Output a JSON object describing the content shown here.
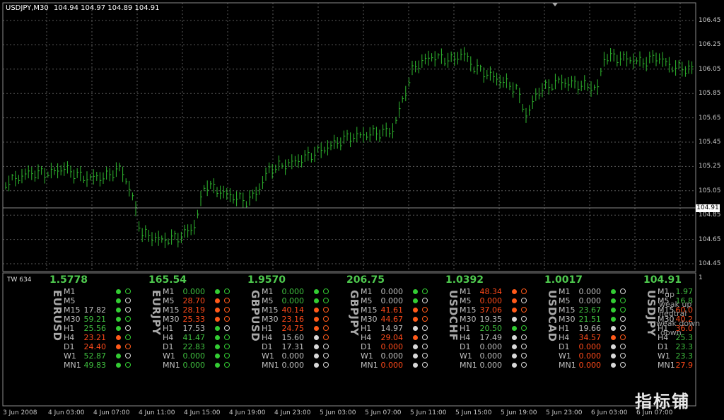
{
  "window": {
    "title": "USDJPY,M30",
    "ohlc": "104.94 104.97 104.89 104.91",
    "current_price": "104.91"
  },
  "indicator_window": {
    "title": "TW 634",
    "scale_max": "1"
  },
  "price_axis": {
    "ticks": [
      "106.45",
      "106.25",
      "106.05",
      "105.85",
      "105.65",
      "105.45",
      "105.25",
      "105.05",
      "104.85",
      "104.65",
      "104.45"
    ]
  },
  "time_axis": {
    "ticks": [
      "3 Jun 2008",
      "4 Jun 03:00",
      "4 Jun 07:00",
      "4 Jun 11:00",
      "4 Jun 15:00",
      "4 Jun 19:00",
      "4 Jun 23:00",
      "5 Jun 03:00",
      "5 Jun 07:00",
      "5 Jun 11:00",
      "5 Jun 15:00",
      "5 Jun 19:00",
      "5 Jun 23:00",
      "6 Jun 03:00",
      "6 Jun 07:00"
    ]
  },
  "colors": {
    "background": "#000000",
    "grid": "#5a5a5a",
    "bars": "#2fb82f",
    "bullish": "#33cc33",
    "bearish": "#ff5a1a",
    "neutral": "#d8d8d8"
  },
  "timeframes": [
    "M1",
    "M5",
    "M15",
    "M30",
    "H1",
    "H4",
    "D1",
    "W1",
    "MN1"
  ],
  "panels": [
    {
      "symbol": "EURUSD",
      "price": "1.5778",
      "rows": [
        {
          "value": "",
          "vc": "w",
          "dot": "g",
          "ring": "g"
        },
        {
          "value": "",
          "vc": "w",
          "dot": "g",
          "ring": "w"
        },
        {
          "value": "17.82",
          "vc": "w",
          "dot": "g",
          "ring": "w"
        },
        {
          "value": "59.21",
          "vc": "g",
          "dot": "g",
          "ring": "g"
        },
        {
          "value": "25.56",
          "vc": "g",
          "dot": "g",
          "ring": "w"
        },
        {
          "value": "23.21",
          "vc": "r",
          "dot": "r",
          "ring": "g"
        },
        {
          "value": "24.40",
          "vc": "r",
          "dot": "r",
          "ring": "r"
        },
        {
          "value": "52.87",
          "vc": "g",
          "dot": "g",
          "ring": "w"
        },
        {
          "value": "49.83",
          "vc": "g",
          "dot": "g",
          "ring": "g"
        }
      ]
    },
    {
      "symbol": "EURJPY",
      "price": "165.54",
      "rows": [
        {
          "value": "0.000",
          "vc": "g",
          "dot": "g",
          "ring": "g"
        },
        {
          "value": "28.70",
          "vc": "r",
          "dot": "r",
          "ring": "r"
        },
        {
          "value": "28.19",
          "vc": "r",
          "dot": "r",
          "ring": "r"
        },
        {
          "value": "25.33",
          "vc": "r",
          "dot": "r",
          "ring": "r"
        },
        {
          "value": "17.53",
          "vc": "w",
          "dot": "g",
          "ring": "w"
        },
        {
          "value": "41.47",
          "vc": "g",
          "dot": "g",
          "ring": "g"
        },
        {
          "value": "22.83",
          "vc": "g",
          "dot": "g",
          "ring": "g"
        },
        {
          "value": "0.000",
          "vc": "g",
          "dot": "g",
          "ring": "g"
        },
        {
          "value": "0.000",
          "vc": "g",
          "dot": "g",
          "ring": "g"
        }
      ]
    },
    {
      "symbol": "GBPUSD",
      "price": "1.9570",
      "rows": [
        {
          "value": "0.000",
          "vc": "g",
          "dot": "g",
          "ring": "g"
        },
        {
          "value": "0.000",
          "vc": "g",
          "dot": "g",
          "ring": "g"
        },
        {
          "value": "40.14",
          "vc": "r",
          "dot": "r",
          "ring": "r"
        },
        {
          "value": "23.16",
          "vc": "r",
          "dot": "r",
          "ring": "r"
        },
        {
          "value": "24.75",
          "vc": "r",
          "dot": "r",
          "ring": "r"
        },
        {
          "value": "15.60",
          "vc": "w",
          "dot": "w",
          "ring": "r"
        },
        {
          "value": "17.31",
          "vc": "w",
          "dot": "w",
          "ring": "w"
        },
        {
          "value": "0.000",
          "vc": "w",
          "dot": "w",
          "ring": "w"
        },
        {
          "value": "0.000",
          "vc": "w",
          "dot": "w",
          "ring": "w"
        }
      ]
    },
    {
      "symbol": "GBPJPY",
      "price": "206.75",
      "rows": [
        {
          "value": "0.000",
          "vc": "w",
          "dot": "g",
          "ring": "g"
        },
        {
          "value": "0.000",
          "vc": "w",
          "dot": "g",
          "ring": "w"
        },
        {
          "value": "41.61",
          "vc": "r",
          "dot": "r",
          "ring": "r"
        },
        {
          "value": "44.67",
          "vc": "r",
          "dot": "r",
          "ring": "r"
        },
        {
          "value": "14.97",
          "vc": "w",
          "dot": "w",
          "ring": "w"
        },
        {
          "value": "29.04",
          "vc": "r",
          "dot": "r",
          "ring": "w"
        },
        {
          "value": "0.000",
          "vc": "r",
          "dot": "w",
          "ring": "w"
        },
        {
          "value": "0.000",
          "vc": "w",
          "dot": "w",
          "ring": "w"
        },
        {
          "value": "0.000",
          "vc": "r",
          "dot": "w",
          "ring": "w"
        }
      ]
    },
    {
      "symbol": "USDCHF",
      "price": "1.0392",
      "rows": [
        {
          "value": "48.34",
          "vc": "r",
          "dot": "r",
          "ring": "r"
        },
        {
          "value": "0.000",
          "vc": "r",
          "dot": "r",
          "ring": "w"
        },
        {
          "value": "37.06",
          "vc": "r",
          "dot": "r",
          "ring": "r"
        },
        {
          "value": "19.35",
          "vc": "w",
          "dot": "w",
          "ring": "w"
        },
        {
          "value": "20.50",
          "vc": "g",
          "dot": "g",
          "ring": "g"
        },
        {
          "value": "17.49",
          "vc": "w",
          "dot": "w",
          "ring": "w"
        },
        {
          "value": "0.000",
          "vc": "w",
          "dot": "w",
          "ring": "w"
        },
        {
          "value": "0.000",
          "vc": "w",
          "dot": "w",
          "ring": "w"
        },
        {
          "value": "0.000",
          "vc": "w",
          "dot": "w",
          "ring": "w"
        }
      ]
    },
    {
      "symbol": "USDCAD",
      "price": "1.0017",
      "rows": [
        {
          "value": "0.000",
          "vc": "w",
          "dot": "g",
          "ring": "w"
        },
        {
          "value": "0.000",
          "vc": "w",
          "dot": "g",
          "ring": "g"
        },
        {
          "value": "23.67",
          "vc": "g",
          "dot": "g",
          "ring": "g"
        },
        {
          "value": "21.51",
          "vc": "g",
          "dot": "g",
          "ring": "w"
        },
        {
          "value": "19.66",
          "vc": "w",
          "dot": "w",
          "ring": "w"
        },
        {
          "value": "34.57",
          "vc": "r",
          "dot": "r",
          "ring": "r"
        },
        {
          "value": "0.000",
          "vc": "r",
          "dot": "w",
          "ring": "w"
        },
        {
          "value": "0.000",
          "vc": "r",
          "dot": "w",
          "ring": "w"
        },
        {
          "value": "0.000",
          "vc": "r",
          "dot": "w",
          "ring": "w"
        }
      ]
    },
    {
      "symbol": "USDJPY",
      "price": "104.91",
      "rows": [
        {
          "value": "1.97",
          "vc": "g",
          "dot": "",
          "ring": ""
        },
        {
          "value": "16.8",
          "vc": "g",
          "dot": "",
          "ring": ""
        },
        {
          "value": "60.0",
          "vc": "r",
          "dot": "",
          "ring": ""
        },
        {
          "value": "40.2",
          "vc": "r",
          "dot": "",
          "ring": ""
        },
        {
          "value": "36.0",
          "vc": "r",
          "dot": "",
          "ring": ""
        },
        {
          "value": "25.3",
          "vc": "g",
          "dot": "",
          "ring": ""
        },
        {
          "value": "23.3",
          "vc": "g",
          "dot": "",
          "ring": ""
        },
        {
          "value": "23.3",
          "vc": "g",
          "dot": "",
          "ring": ""
        },
        {
          "value": "27.9",
          "vc": "r",
          "dot": "",
          "ring": ""
        }
      ]
    }
  ],
  "overlay_words": [
    "up",
    "weak up",
    "neutral",
    "weak down",
    "down"
  ],
  "watermark": "指标铺"
}
